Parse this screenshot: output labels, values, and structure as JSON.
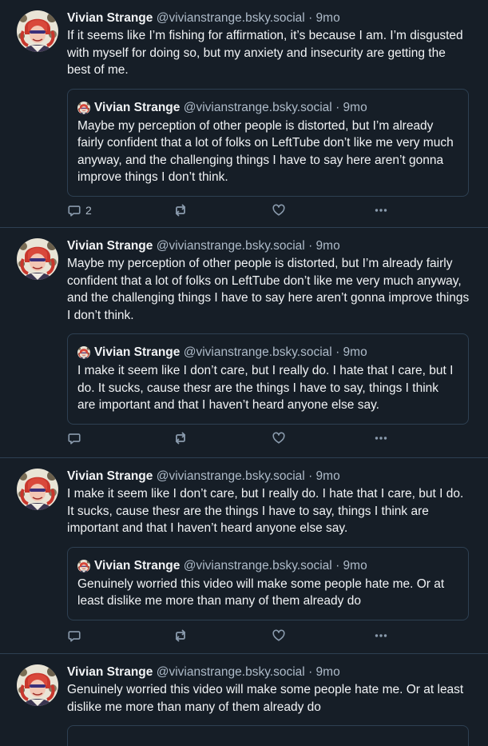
{
  "posts": [
    {
      "author": {
        "name": "Vivian Strange",
        "handle": "@vivianstrange.bsky.social",
        "time": "9mo"
      },
      "text": "If it seems like I’m fishing for affirmation, it’s because I am. I’m disgusted with myself for doing so, but my anxiety and insecurity are getting the best of me.",
      "quote": {
        "author": {
          "name": "Vivian Strange",
          "handle": "@vivianstrange.bsky.social",
          "time": "9mo"
        },
        "text": "Maybe my perception of other people is distorted, but I’m already fairly confident that a lot of folks on LeftTube don’t like me very much anyway, and the challenging things I have to say here aren’t gonna improve things I don’t think."
      },
      "actions": {
        "reply_count": "2"
      }
    },
    {
      "author": {
        "name": "Vivian Strange",
        "handle": "@vivianstrange.bsky.social",
        "time": "9mo"
      },
      "text": "Maybe my perception of other people is distorted, but I’m already fairly confident that a lot of folks on LeftTube don’t like me very much anyway, and the challenging things I have to say here aren’t gonna improve things I don’t think.",
      "quote": {
        "author": {
          "name": "Vivian Strange",
          "handle": "@vivianstrange.bsky.social",
          "time": "9mo"
        },
        "text": "I make it seem like I don’t care, but I really do. I hate that I care, but I do. It sucks, cause thesr are the things I have to say, things I think are important and that I haven’t heard anyone else say."
      },
      "actions": {
        "reply_count": ""
      }
    },
    {
      "author": {
        "name": "Vivian Strange",
        "handle": "@vivianstrange.bsky.social",
        "time": "9mo"
      },
      "text": "I make it seem like I don’t care, but I really do. I hate that I care, but I do. It sucks, cause thesr are the things I have to say, things I think are important and that I haven’t heard anyone else say.",
      "quote": {
        "author": {
          "name": "Vivian Strange",
          "handle": "@vivianstrange.bsky.social",
          "time": "9mo"
        },
        "text": "Genuinely worried this video will make some people hate me. Or at least dislike me more than many of them already do"
      },
      "actions": {
        "reply_count": ""
      }
    },
    {
      "author": {
        "name": "Vivian Strange",
        "handle": "@vivianstrange.bsky.social",
        "time": "9mo"
      },
      "text": "Genuinely worried this video will make some people hate me. Or at least dislike me more than many of them already do"
    }
  ],
  "separator": "·",
  "icons": {
    "reply": "reply-bubble-icon",
    "repost": "repost-icon",
    "like": "heart-icon",
    "more": "more-dots-icon"
  },
  "colors": {
    "background": "#161e27",
    "border": "#2e4052",
    "text": "#f1f3f5",
    "muted": "#aebbc9",
    "icon": "#8a9bad"
  }
}
